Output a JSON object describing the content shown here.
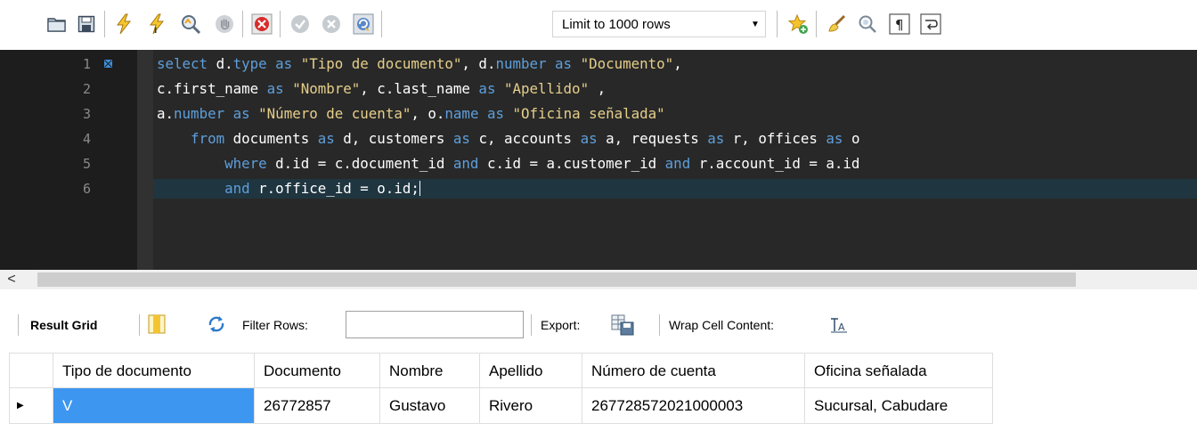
{
  "toolbar": {
    "limit_select_value": "Limit to 1000 rows",
    "icons": [
      "open-folder-icon",
      "save-icon",
      "execute-icon",
      "execute-current-icon",
      "explain-icon",
      "stop-icon",
      "toggle-error-icon",
      "commit-icon",
      "rollback-icon",
      "autocommit-icon",
      "limit-dropdown-icon",
      "snippet-icon",
      "beautify-icon",
      "find-icon",
      "invisible-chars-icon",
      "wrap-lines-icon"
    ]
  },
  "editor": {
    "line_numbers": [
      "1",
      "2",
      "3",
      "4",
      "5",
      "6"
    ],
    "lines": [
      [
        {
          "t": "kw",
          "v": "select "
        },
        {
          "t": "id",
          "v": "d."
        },
        {
          "t": "kw",
          "v": "type"
        },
        {
          "t": "kw",
          "v": " as "
        },
        {
          "t": "str",
          "v": "\"Tipo de documento\""
        },
        {
          "t": "id",
          "v": ", d."
        },
        {
          "t": "kw",
          "v": "number"
        },
        {
          "t": "kw",
          "v": " as "
        },
        {
          "t": "str",
          "v": "\"Documento\""
        },
        {
          "t": "id",
          "v": ","
        }
      ],
      [
        {
          "t": "id",
          "v": "c.first_name"
        },
        {
          "t": "kw",
          "v": " as "
        },
        {
          "t": "str",
          "v": "\"Nombre\""
        },
        {
          "t": "id",
          "v": ", c.last_name"
        },
        {
          "t": "kw",
          "v": " as "
        },
        {
          "t": "str",
          "v": "\"Apellido\""
        },
        {
          "t": "id",
          "v": " ,"
        }
      ],
      [
        {
          "t": "id",
          "v": "a."
        },
        {
          "t": "kw",
          "v": "number"
        },
        {
          "t": "kw",
          "v": " as "
        },
        {
          "t": "str",
          "v": "\"Número de cuenta\""
        },
        {
          "t": "id",
          "v": ", o."
        },
        {
          "t": "kw",
          "v": "name"
        },
        {
          "t": "kw",
          "v": " as "
        },
        {
          "t": "str",
          "v": "\"Oficina señalada\""
        }
      ],
      [
        {
          "t": "id",
          "v": "    "
        },
        {
          "t": "kw",
          "v": "from"
        },
        {
          "t": "id",
          "v": " documents "
        },
        {
          "t": "kw",
          "v": "as"
        },
        {
          "t": "id",
          "v": " d, customers "
        },
        {
          "t": "kw",
          "v": "as"
        },
        {
          "t": "id",
          "v": " c, accounts "
        },
        {
          "t": "kw",
          "v": "as"
        },
        {
          "t": "id",
          "v": " a, requests "
        },
        {
          "t": "kw",
          "v": "as"
        },
        {
          "t": "id",
          "v": " r, offices "
        },
        {
          "t": "kw",
          "v": "as"
        },
        {
          "t": "id",
          "v": " o"
        }
      ],
      [
        {
          "t": "id",
          "v": "        "
        },
        {
          "t": "kw",
          "v": "where"
        },
        {
          "t": "id",
          "v": " d.id = c.document_id "
        },
        {
          "t": "kw",
          "v": "and"
        },
        {
          "t": "id",
          "v": " c.id = a.customer_id "
        },
        {
          "t": "kw",
          "v": "and"
        },
        {
          "t": "id",
          "v": " r.account_id = a.id"
        }
      ],
      [
        {
          "t": "id",
          "v": "        "
        },
        {
          "t": "kw",
          "v": "and"
        },
        {
          "t": "id",
          "v": " r.office_id = o.id;"
        }
      ]
    ],
    "current_line": 6
  },
  "result_toolbar": {
    "result_grid_label": "Result Grid",
    "filter_rows_label": "Filter Rows:",
    "filter_rows_value": "",
    "export_label": "Export:",
    "wrap_cell_label": "Wrap Cell Content:"
  },
  "grid": {
    "columns": [
      "Tipo de documento",
      "Documento",
      "Nombre",
      "Apellido",
      "Número de cuenta",
      "Oficina señalada"
    ],
    "rows": [
      [
        "V",
        "26772857",
        "Gustavo",
        "Rivero",
        "267728572021000003",
        "Sucursal, Cabudare"
      ]
    ],
    "selected_cell": [
      0,
      0
    ]
  },
  "colors": {
    "editor_bg": "#282828",
    "gutter_bg": "#1d1d1d",
    "keyword": "#5e9fdb",
    "string": "#e6cf8a",
    "current_line": "#1f3540",
    "selection": "#3d97f0"
  }
}
